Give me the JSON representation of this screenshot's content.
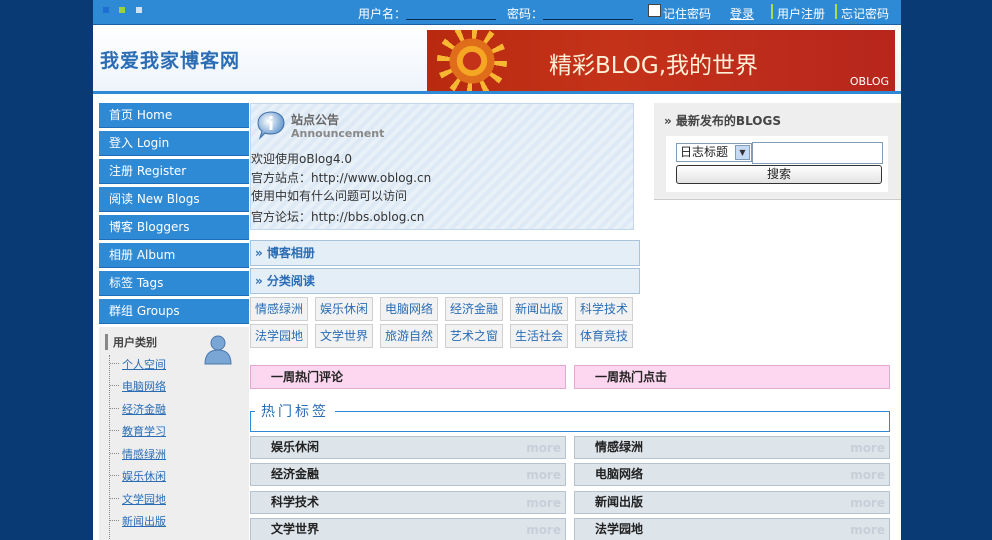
{
  "topbar": {
    "username_label": "用户名：",
    "password_label": "密码：",
    "remember_label": "记住密码",
    "login_link": "登录",
    "register_link": "用户注册",
    "forgot_link": "忘记密码"
  },
  "header": {
    "site_title": "我爱我家博客网",
    "banner_text": "精彩BLOG,我的世界",
    "banner_brand": "OBLOG"
  },
  "nav": {
    "items": [
      {
        "label": "首页 Home"
      },
      {
        "label": "登入 Login"
      },
      {
        "label": "注册 Register"
      },
      {
        "label": "阅读 New Blogs"
      },
      {
        "label": "博客 Bloggers"
      },
      {
        "label": "相册 Album"
      },
      {
        "label": "标签 Tags"
      },
      {
        "label": "群组 Groups"
      }
    ]
  },
  "user_category": {
    "title": "用户类别",
    "items": [
      "个人空间",
      "电脑网络",
      "经济金融",
      "教育学习",
      "情感绿洲",
      "娱乐休闲",
      "文学园地",
      "新闻出版"
    ]
  },
  "announcement": {
    "title": "站点公告",
    "subtitle": "Announcement",
    "lines": [
      "欢迎使用oBlog4.0",
      "官方站点：http://www.oblog.cn",
      "使用中如有什么问题可以访问",
      "官方论坛：http://bbs.oblog.cn"
    ]
  },
  "sections": {
    "album": "» 博客相册",
    "category": "» 分类阅读"
  },
  "categories": [
    "情感绿洲",
    "娱乐休闲",
    "电脑网络",
    "经济金融",
    "新闻出版",
    "科学技术",
    "法学园地",
    "文学世界",
    "旅游自然",
    "艺术之窗",
    "生活社会",
    "体育竞技"
  ],
  "latest": {
    "title": "» 最新发布的BLOGS",
    "search_option": "日志标题",
    "search_button": "搜索"
  },
  "hot": {
    "comments": "一周热门评论",
    "clicks": "一周热门点击"
  },
  "hot_tags": {
    "title": "热门标签",
    "more_label": "more",
    "rows": [
      "娱乐休闲",
      "情感绿洲",
      "经济金融",
      "电脑网络",
      "科学技术",
      "新闻出版",
      "文学世界",
      "法学园地"
    ]
  },
  "colors": {
    "accent": "#2f8ad6",
    "background": "#0a3a73",
    "pink_bar": "#fdd7f0"
  }
}
